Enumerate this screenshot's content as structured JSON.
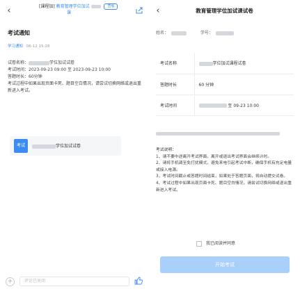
{
  "left": {
    "header": {
      "tag": "[课程加]",
      "link": "教育管理学位加试",
      "link_tail": "课",
      "btn_label": "查看"
    },
    "notice_title": "考试通知",
    "meta": {
      "source": "学习通知",
      "datetime": "06-12 15:28"
    },
    "body": {
      "exam_name_label": "试卷名称：",
      "exam_name_value": "学位加试试卷",
      "time_label": "考试时间：",
      "time_value": "2023-09-23 09:00 至 2023-09-23 10:00",
      "duration_label": "答题时长：",
      "duration_value": "60分钟",
      "tip": "考试过程中如果出现页面卡死、题目空白情况，请尝试切换网络或退出重新进入考试。"
    },
    "attachment": {
      "icon_label": "考试",
      "name": "学位加试试卷"
    },
    "comment": {
      "placeholder": "评论已关闭"
    }
  },
  "right": {
    "header": {
      "title": "教育管理学位加试课试卷"
    },
    "user": {
      "name_label": "姓名：",
      "id_label": "学号："
    },
    "table": [
      {
        "key": "考试名称",
        "value": "学位加试课程试卷"
      },
      {
        "key": "答题时长",
        "value": "60 分钟"
      },
      {
        "key": "考试时间",
        "value": "至 09-23 10:00"
      }
    ],
    "instructions": {
      "title": "考试说明：",
      "items": [
        "1、请不要中途离开考试界面，离开或退出考试界面会继续计时。",
        "2、请将手机调至免打扰模式，避免来电引起考试中断，确保手机有充足电量或接入电源。",
        "3、考试时间截止或答题时间结束，如果处于答题页面，将自动提交试卷。",
        "4、考试过程中如果出现页面卡死、题目空白情况，请尝试切换网络或退出重新进入考试。"
      ]
    },
    "agree_label": "我已阅读并同意",
    "start_button": "开始考试"
  }
}
